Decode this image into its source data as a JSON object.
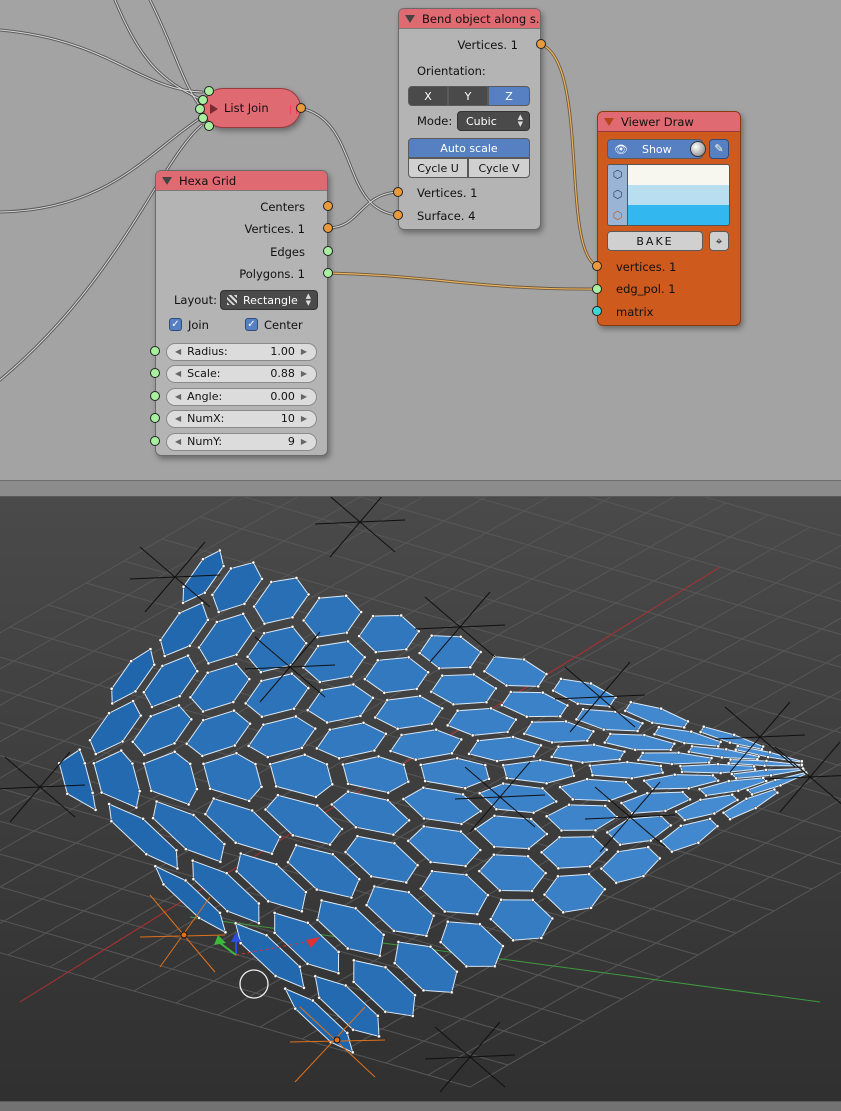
{
  "node_editor": {
    "nodes": {
      "list_join": {
        "title": "List Join",
        "color": "#e06a72"
      },
      "bend": {
        "title": "Bend object along s...",
        "out_vertices": "Vertices. 1",
        "orientation_label": "Orientation:",
        "axes": [
          "X",
          "Y",
          "Z"
        ],
        "active_axis": "Z",
        "mode_label": "Mode:",
        "mode_value": "Cubic",
        "auto_scale": "Auto scale",
        "cycle_u": "Cycle U",
        "cycle_v": "Cycle V",
        "in_vertices": "Vertices. 1",
        "in_surface": "Surface. 4"
      },
      "hexa": {
        "title": "Hexa Grid",
        "outputs": [
          "Centers",
          "Vertices. 1",
          "Edges",
          "Polygons. 1"
        ],
        "layout_label": "Layout:",
        "layout_value": "Rectangle",
        "join_label": "Join",
        "center_label": "Center",
        "params": [
          {
            "label": "Radius:",
            "value": "1.00"
          },
          {
            "label": "Scale:",
            "value": "0.88"
          },
          {
            "label": "Angle:",
            "value": "0.00"
          },
          {
            "label": "NumX:",
            "value": "10"
          },
          {
            "label": "NumY:",
            "value": "9"
          }
        ]
      },
      "viewer": {
        "title": "Viewer Draw",
        "color": "#cf5a1e",
        "show": "Show",
        "bake": "BAKE",
        "swatches": [
          "#f7f7f0",
          "#b8def0",
          "#32b8ef"
        ],
        "in_vertices": "vertices. 1",
        "in_edgpol": "edg_pol. 1",
        "in_matrix": "matrix"
      }
    }
  },
  "viewport": {
    "mesh_color": "#2b79c8",
    "edge_color": "#dbe9f7"
  }
}
